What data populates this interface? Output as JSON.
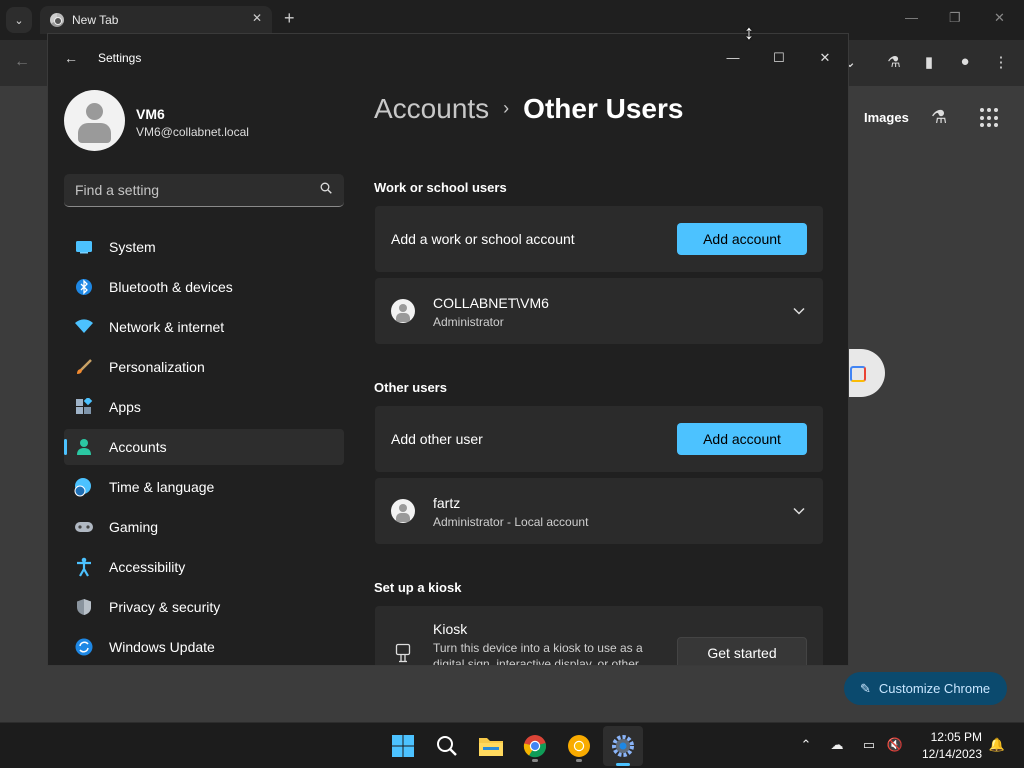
{
  "chrome": {
    "tab_title": "New Tab",
    "images_link": "Images",
    "customize_label": "Customize Chrome"
  },
  "settings": {
    "window_title": "Settings",
    "profile": {
      "name": "VM6",
      "email": "VM6@collabnet.local"
    },
    "search_placeholder": "Find a setting",
    "nav": [
      {
        "label": "System",
        "icon": "system-icon"
      },
      {
        "label": "Bluetooth & devices",
        "icon": "bluetooth-icon"
      },
      {
        "label": "Network & internet",
        "icon": "wifi-icon"
      },
      {
        "label": "Personalization",
        "icon": "brush-icon"
      },
      {
        "label": "Apps",
        "icon": "apps-icon"
      },
      {
        "label": "Accounts",
        "icon": "accounts-icon",
        "active": true
      },
      {
        "label": "Time & language",
        "icon": "globe-clock-icon"
      },
      {
        "label": "Gaming",
        "icon": "gamepad-icon"
      },
      {
        "label": "Accessibility",
        "icon": "accessibility-icon"
      },
      {
        "label": "Privacy & security",
        "icon": "shield-icon"
      },
      {
        "label": "Windows Update",
        "icon": "update-icon"
      }
    ],
    "breadcrumb": {
      "parent": "Accounts",
      "separator": "›",
      "current": "Other Users"
    },
    "work_section": {
      "title": "Work or school users",
      "add_text": "Add a work or school account",
      "add_button": "Add account",
      "user": {
        "name": "COLLABNET\\VM6",
        "role": "Administrator"
      }
    },
    "other_section": {
      "title": "Other users",
      "add_text": "Add other user",
      "add_button": "Add account",
      "user": {
        "name": "fartz",
        "role": "Administrator - Local account"
      }
    },
    "kiosk_section": {
      "title": "Set up a kiosk",
      "card_title": "Kiosk",
      "card_desc": "Turn this device into a kiosk to use as a digital sign, interactive display, or other things",
      "button": "Get started"
    }
  },
  "taskbar": {
    "time": "12:05 PM",
    "date": "12/14/2023"
  },
  "colors": {
    "accent": "#4cc2ff",
    "window_bg": "#202020",
    "card_bg": "#2b2b2b"
  }
}
